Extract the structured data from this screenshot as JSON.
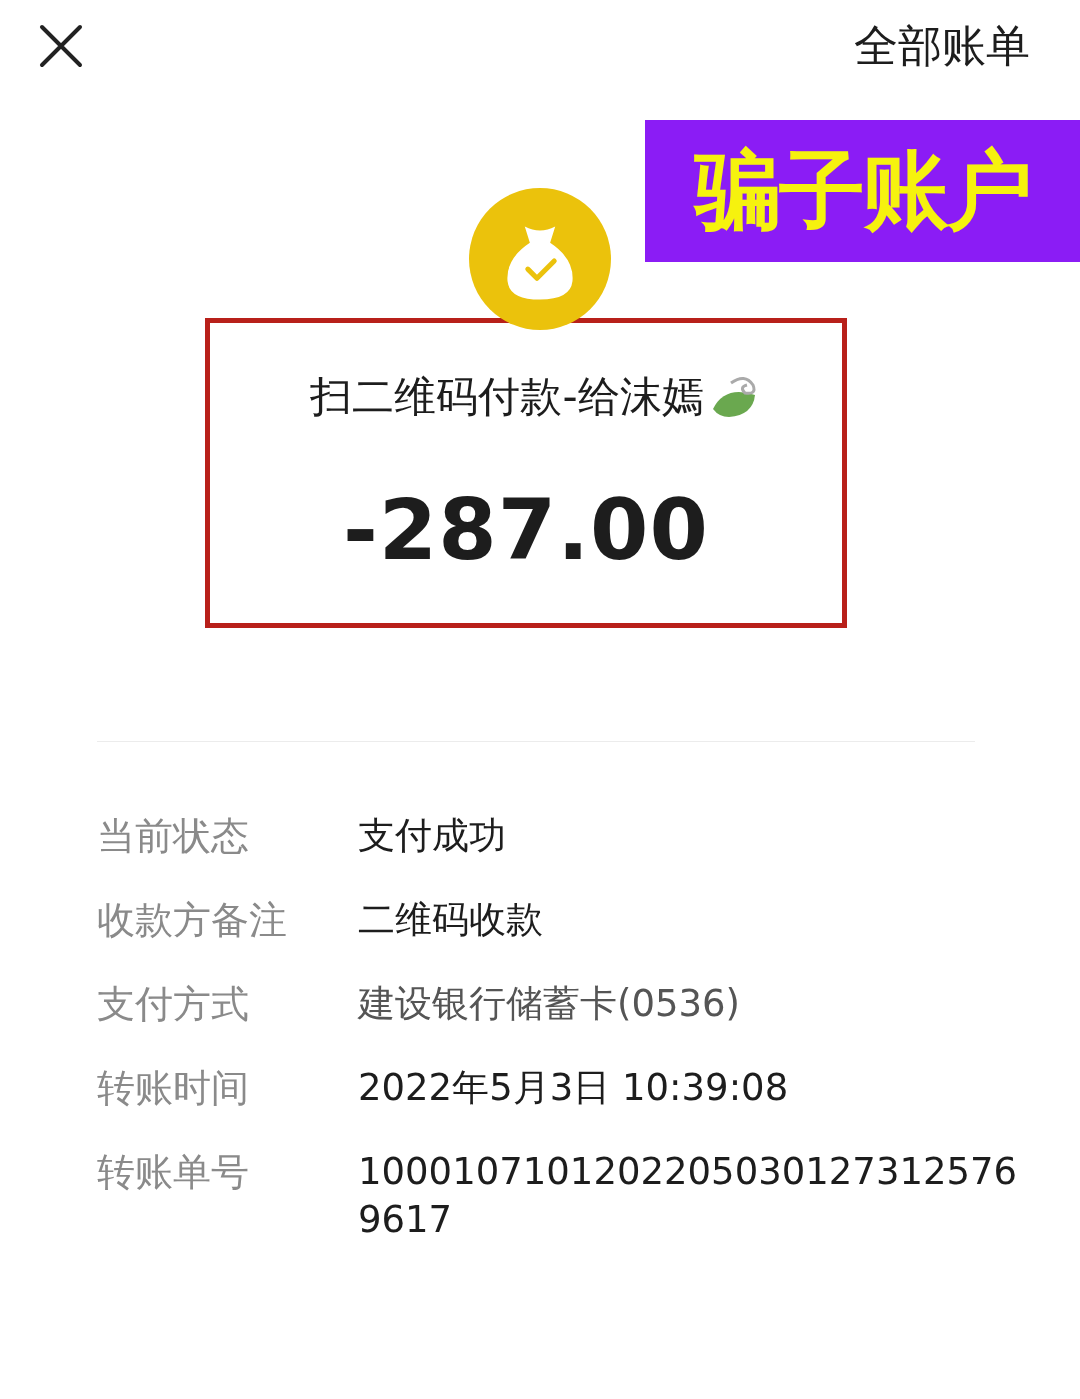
{
  "header": {
    "all_bills_link": "全部账单"
  },
  "annotation": {
    "label": "骗子账户"
  },
  "transaction": {
    "title": "扫二维码付款-给沫嫣",
    "amount": "-287.00"
  },
  "details": [
    {
      "label": "当前状态",
      "value": "支付成功",
      "kind": "plain"
    },
    {
      "label": "收款方备注",
      "value": "二维码收款",
      "kind": "plain"
    },
    {
      "label": "支付方式",
      "value": "建设银行储蓄卡(0536)",
      "kind": "blurred"
    },
    {
      "label": "转账时间",
      "value": "2022年5月3日 10:39:08",
      "kind": "plain"
    },
    {
      "label": "转账单号",
      "value": "10001071012022050301273125769617",
      "kind": "plain"
    }
  ]
}
